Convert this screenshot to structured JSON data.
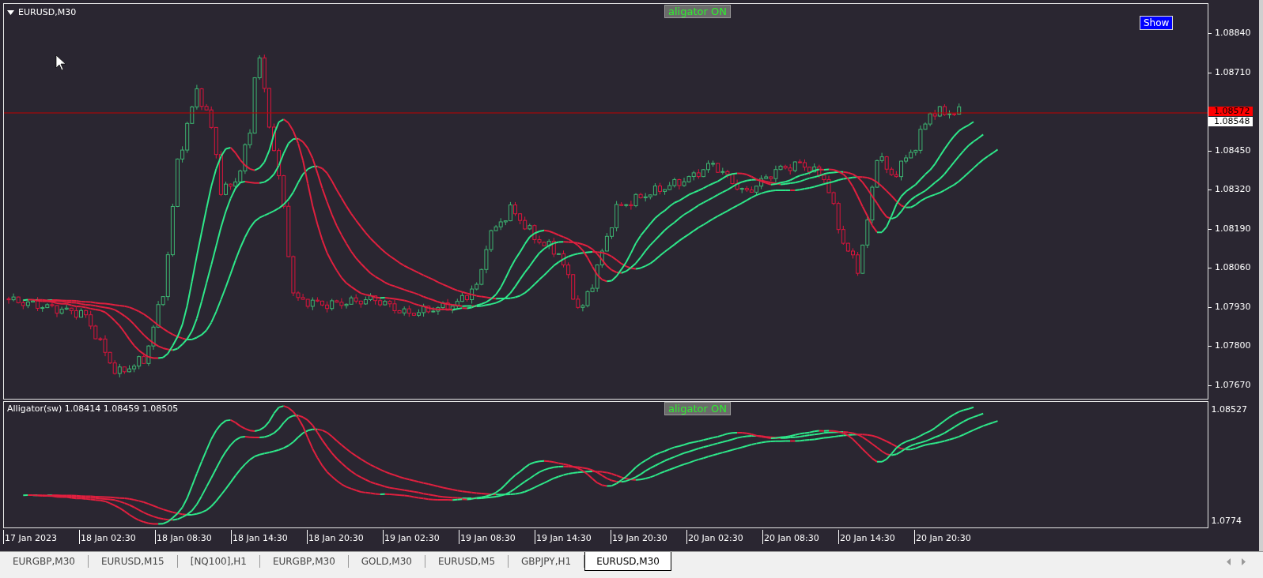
{
  "chart": {
    "title": "EURUSD,M30",
    "status_label": "aligator ON",
    "show_button": "Show",
    "price_axis": [
      "1.08840",
      "1.08710",
      "1.08450",
      "1.08320",
      "1.08190",
      "1.08060",
      "1.07930",
      "1.07800",
      "1.07670"
    ],
    "bid_price": "1.08572",
    "current_price": "1.08548"
  },
  "indicator": {
    "title": "Alligator(sw) 1.08414 1.08459 1.08505",
    "status_label": "aligator ON",
    "price_axis": [
      "1.08527",
      "1.0774"
    ]
  },
  "time_axis": [
    "17 Jan 2023",
    "18 Jan 02:30",
    "18 Jan 08:30",
    "18 Jan 14:30",
    "18 Jan 20:30",
    "19 Jan 02:30",
    "19 Jan 08:30",
    "19 Jan 14:30",
    "19 Jan 20:30",
    "20 Jan 02:30",
    "20 Jan 08:30",
    "20 Jan 14:30",
    "20 Jan 20:30"
  ],
  "tabs": [
    {
      "label": "EURGBP,M30",
      "selected": false
    },
    {
      "label": "EURUSD,M15",
      "selected": false
    },
    {
      "label": "[NQ100],H1",
      "selected": false
    },
    {
      "label": "EURGBP,M30",
      "selected": false
    },
    {
      "label": "GOLD,M30",
      "selected": false
    },
    {
      "label": "EURUSD,M5",
      "selected": false
    },
    {
      "label": "GBPJPY,H1",
      "selected": false
    },
    {
      "label": "EURUSD,M30",
      "selected": true
    }
  ]
}
